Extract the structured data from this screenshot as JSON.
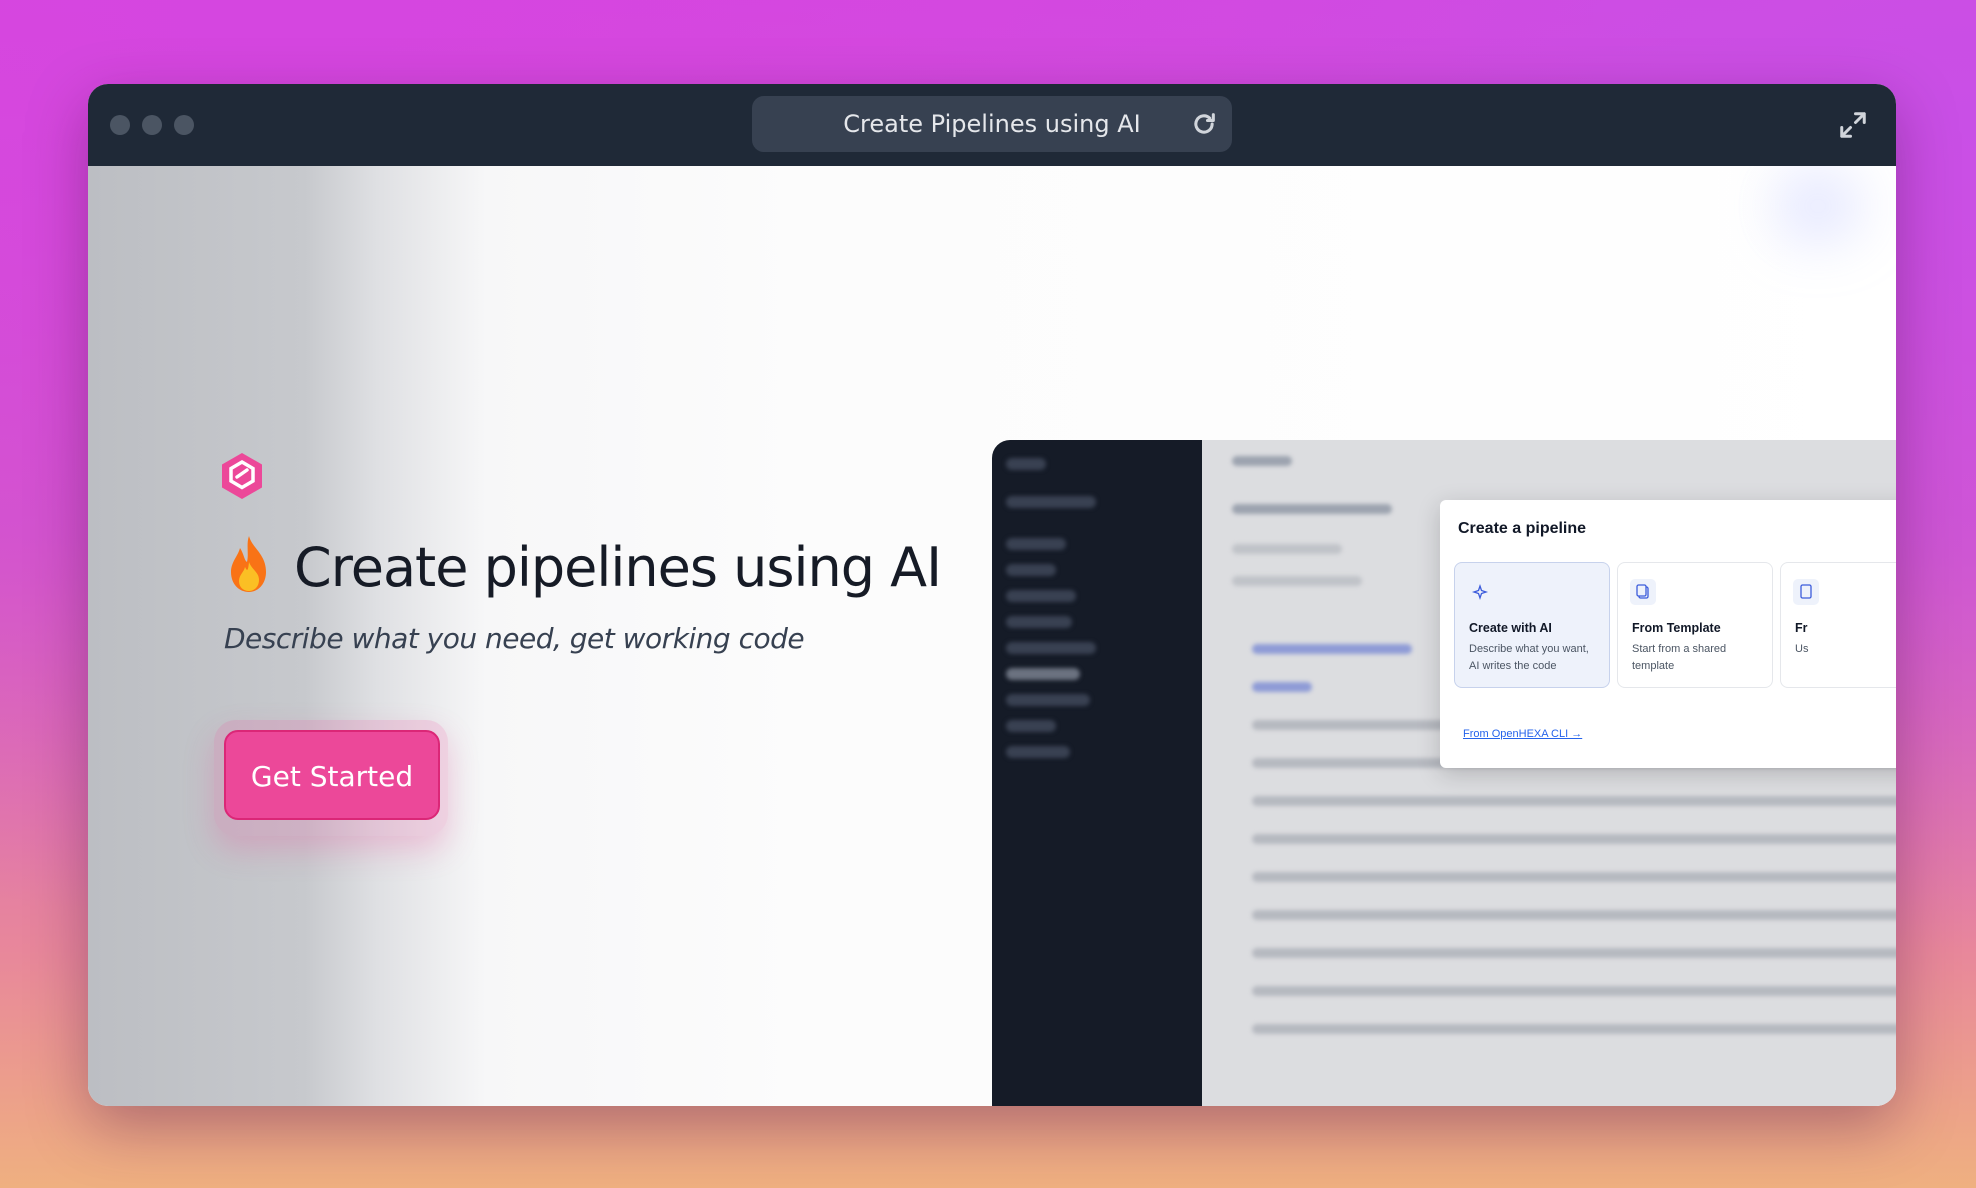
{
  "window": {
    "address_bar_title": "Create Pipelines using AI",
    "reload_icon": "reload-icon",
    "expand_icon": "expand-icon"
  },
  "hero": {
    "logo_icon": "hexagon-logo-icon",
    "emoji_icon": "fire-icon",
    "headline": "Create pipelines using AI",
    "subtitle": "Describe what you need, get working code",
    "cta_label": "Get Started",
    "accent_color": "#ec4899"
  },
  "preview": {
    "modal_title": "Create a pipeline",
    "options": [
      {
        "title": "Create with AI",
        "description": "Describe what you want, AI writes the code",
        "icon": "sparkles-icon",
        "selected": true
      },
      {
        "title": "From Template",
        "description": "Start from a shared template",
        "icon": "copy-icon",
        "selected": false
      },
      {
        "title": "Fr",
        "description": "Us",
        "icon": "file-icon",
        "selected": false
      }
    ],
    "cli_link": "From OpenHEXA CLI →"
  }
}
